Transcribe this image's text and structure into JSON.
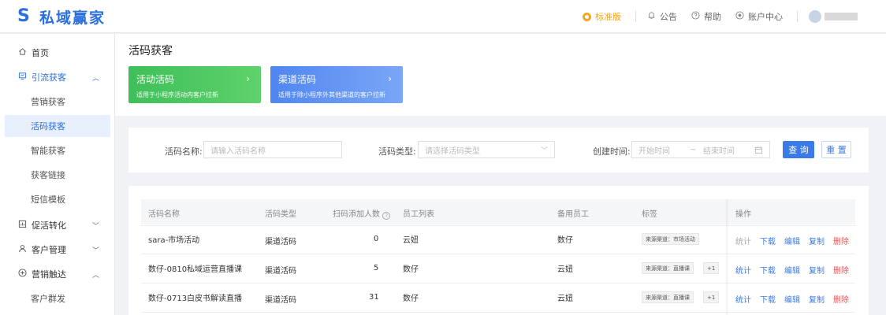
{
  "header": {
    "logo_glyph": "S",
    "logo_text": "私域赢家",
    "edition": "标准版",
    "announcement": "公告",
    "help": "帮助",
    "account_center": "账户中心"
  },
  "sidebar": {
    "home": "首页",
    "lead_acquisition": "引流获客",
    "sub_items": [
      "营销获客",
      "活码获客",
      "智能获客",
      "获客链接",
      "短信模板"
    ],
    "promotion": "促活转化",
    "customer_mgmt": "客户管理",
    "marketing_reach": "营销触达",
    "customer_group": "客户群发"
  },
  "page": {
    "title": "活码获客"
  },
  "cards": [
    {
      "title": "活动活码",
      "desc": "适用于小程序活动内客户拉新",
      "color": "#3fbf5a"
    },
    {
      "title": "渠道活码",
      "desc": "适用于除小程序外其他渠道的客户拉新",
      "color": "#4f86f0"
    }
  ],
  "filters": {
    "name_label": "活码名称:",
    "name_placeholder": "请输入活码名称",
    "type_label": "活码类型:",
    "type_placeholder": "请选择活码类型",
    "time_label": "创建时间:",
    "start_placeholder": "开始时间",
    "range_sep": "~",
    "end_placeholder": "结束时间",
    "search_btn": "查 询",
    "reset_btn": "重 置"
  },
  "table": {
    "columns": [
      "活码名称",
      "活码类型",
      "扫码添加人数",
      "员工列表",
      "备用员工",
      "标签",
      "操作"
    ],
    "rows": [
      {
        "name": "sara-市场活动",
        "type": "渠道活码",
        "count": "0",
        "staff": "云妞",
        "backup": "数仔",
        "tag": "来源渠道：市场活动",
        "extra": ""
      },
      {
        "name": "数仔-0810私域运营直播课",
        "type": "渠道活码",
        "count": "5",
        "staff": "数仔",
        "backup": "云妞",
        "tag": "来源渠道：直播课",
        "extra": "+1"
      },
      {
        "name": "数仔-0713白皮书解读直播",
        "type": "渠道活码",
        "count": "31",
        "staff": "数仔",
        "backup": "云妞",
        "tag": "来源渠道：直播课",
        "extra": "+1"
      }
    ],
    "ops": [
      "统计",
      "下载",
      "编辑",
      "复制",
      "删除"
    ]
  },
  "colors": {
    "primary": "#3a7be8",
    "brand": "#2a6fdb",
    "danger": "#f05050",
    "edition": "#f5a623"
  }
}
